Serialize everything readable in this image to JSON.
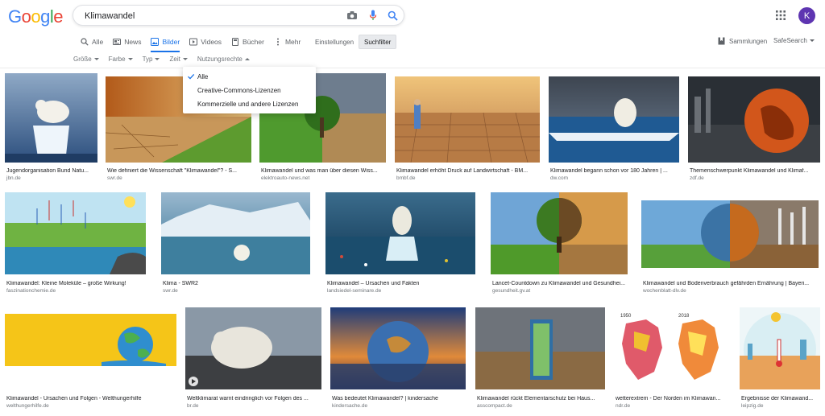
{
  "header": {
    "logo": [
      "G",
      "o",
      "o",
      "g",
      "l",
      "e"
    ],
    "logo_colors": [
      "#4285F4",
      "#EA4335",
      "#FBBC05",
      "#4285F4",
      "#34A853",
      "#EA4335"
    ],
    "query": "Klimawandel",
    "avatar_letter": "K"
  },
  "tabs": [
    {
      "label": "Alle",
      "icon": "search-icon"
    },
    {
      "label": "News",
      "icon": "news-icon"
    },
    {
      "label": "Bilder",
      "icon": "image-icon",
      "active": true
    },
    {
      "label": "Videos",
      "icon": "video-icon"
    },
    {
      "label": "Bücher",
      "icon": "book-icon"
    },
    {
      "label": "Mehr",
      "icon": "more-icon"
    }
  ],
  "tools": {
    "settings": "Einstellungen",
    "search_filter": "Suchfilter"
  },
  "right": {
    "collections": "Sammlungen",
    "safesearch": "SafeSearch"
  },
  "filters": [
    "Größe",
    "Farbe",
    "Typ",
    "Zeit",
    "Nutzungsrechte"
  ],
  "usage_rights_menu": [
    "Alle",
    "Creative-Commons-Lizenzen",
    "Kommerzielle und andere Lizenzen"
  ],
  "accent": "#1a73e8",
  "results": [
    {
      "caption": "Jugendorganisation Bund Natu...",
      "source": "jbn.de"
    },
    {
      "caption": "Wie definiert die Wissenschaft \"Klimawandel\"? - S...",
      "source": "swr.de"
    },
    {
      "caption": "Klimawandel und was man über diesen Wiss...",
      "source": "elektroauto-news.net"
    },
    {
      "caption": "Klimawandel erhöht Druck auf Landwirtschaft - BM...",
      "source": "bmbf.de"
    },
    {
      "caption": "Klimawandel begann schon vor 180 Jahren | ...",
      "source": "dw.com"
    },
    {
      "caption": "Themenschwerpunkt Klimawandel und Klimaf...",
      "source": "zdf.de"
    },
    {
      "caption": "Klimawandel: Kleine Moleküle – große Wirkung!",
      "source": "faszinationchemie.de"
    },
    {
      "caption": "Klima - SWR2",
      "source": "swr.de"
    },
    {
      "caption": "Klimawandel – Ursachen und Fakten",
      "source": "landsiedel-seminare.de"
    },
    {
      "caption": "Lancet-Countdown zu Klimawandel und Gesundhei...",
      "source": "gesundheit.gv.at"
    },
    {
      "caption": "Klimawandel und Bodenverbrauch gefährden Ernährung | Bayeri...",
      "source": "wochenblatt-dlv.de"
    },
    {
      "caption": "Klimawandel - Ursachen und Folgen - Welthungerhilfe",
      "source": "welthungerhilfe.de"
    },
    {
      "caption": "Weltklimarat warnt eindringlich vor Folgen des ...",
      "source": "br.de"
    },
    {
      "caption": "Was bedeutet Klimawandel? | kindersache",
      "source": "kindersache.de"
    },
    {
      "caption": "Klimawandel rückt Elementarschutz bei Haus...",
      "source": "asscompact.de"
    },
    {
      "caption": "wetterextrem - Der Norden im Klimawan...",
      "source": "ndr.de"
    },
    {
      "caption": "Ergebnisse der Klimawand...",
      "source": "leipzig.de"
    }
  ],
  "map_years": [
    "1950",
    "2018"
  ]
}
